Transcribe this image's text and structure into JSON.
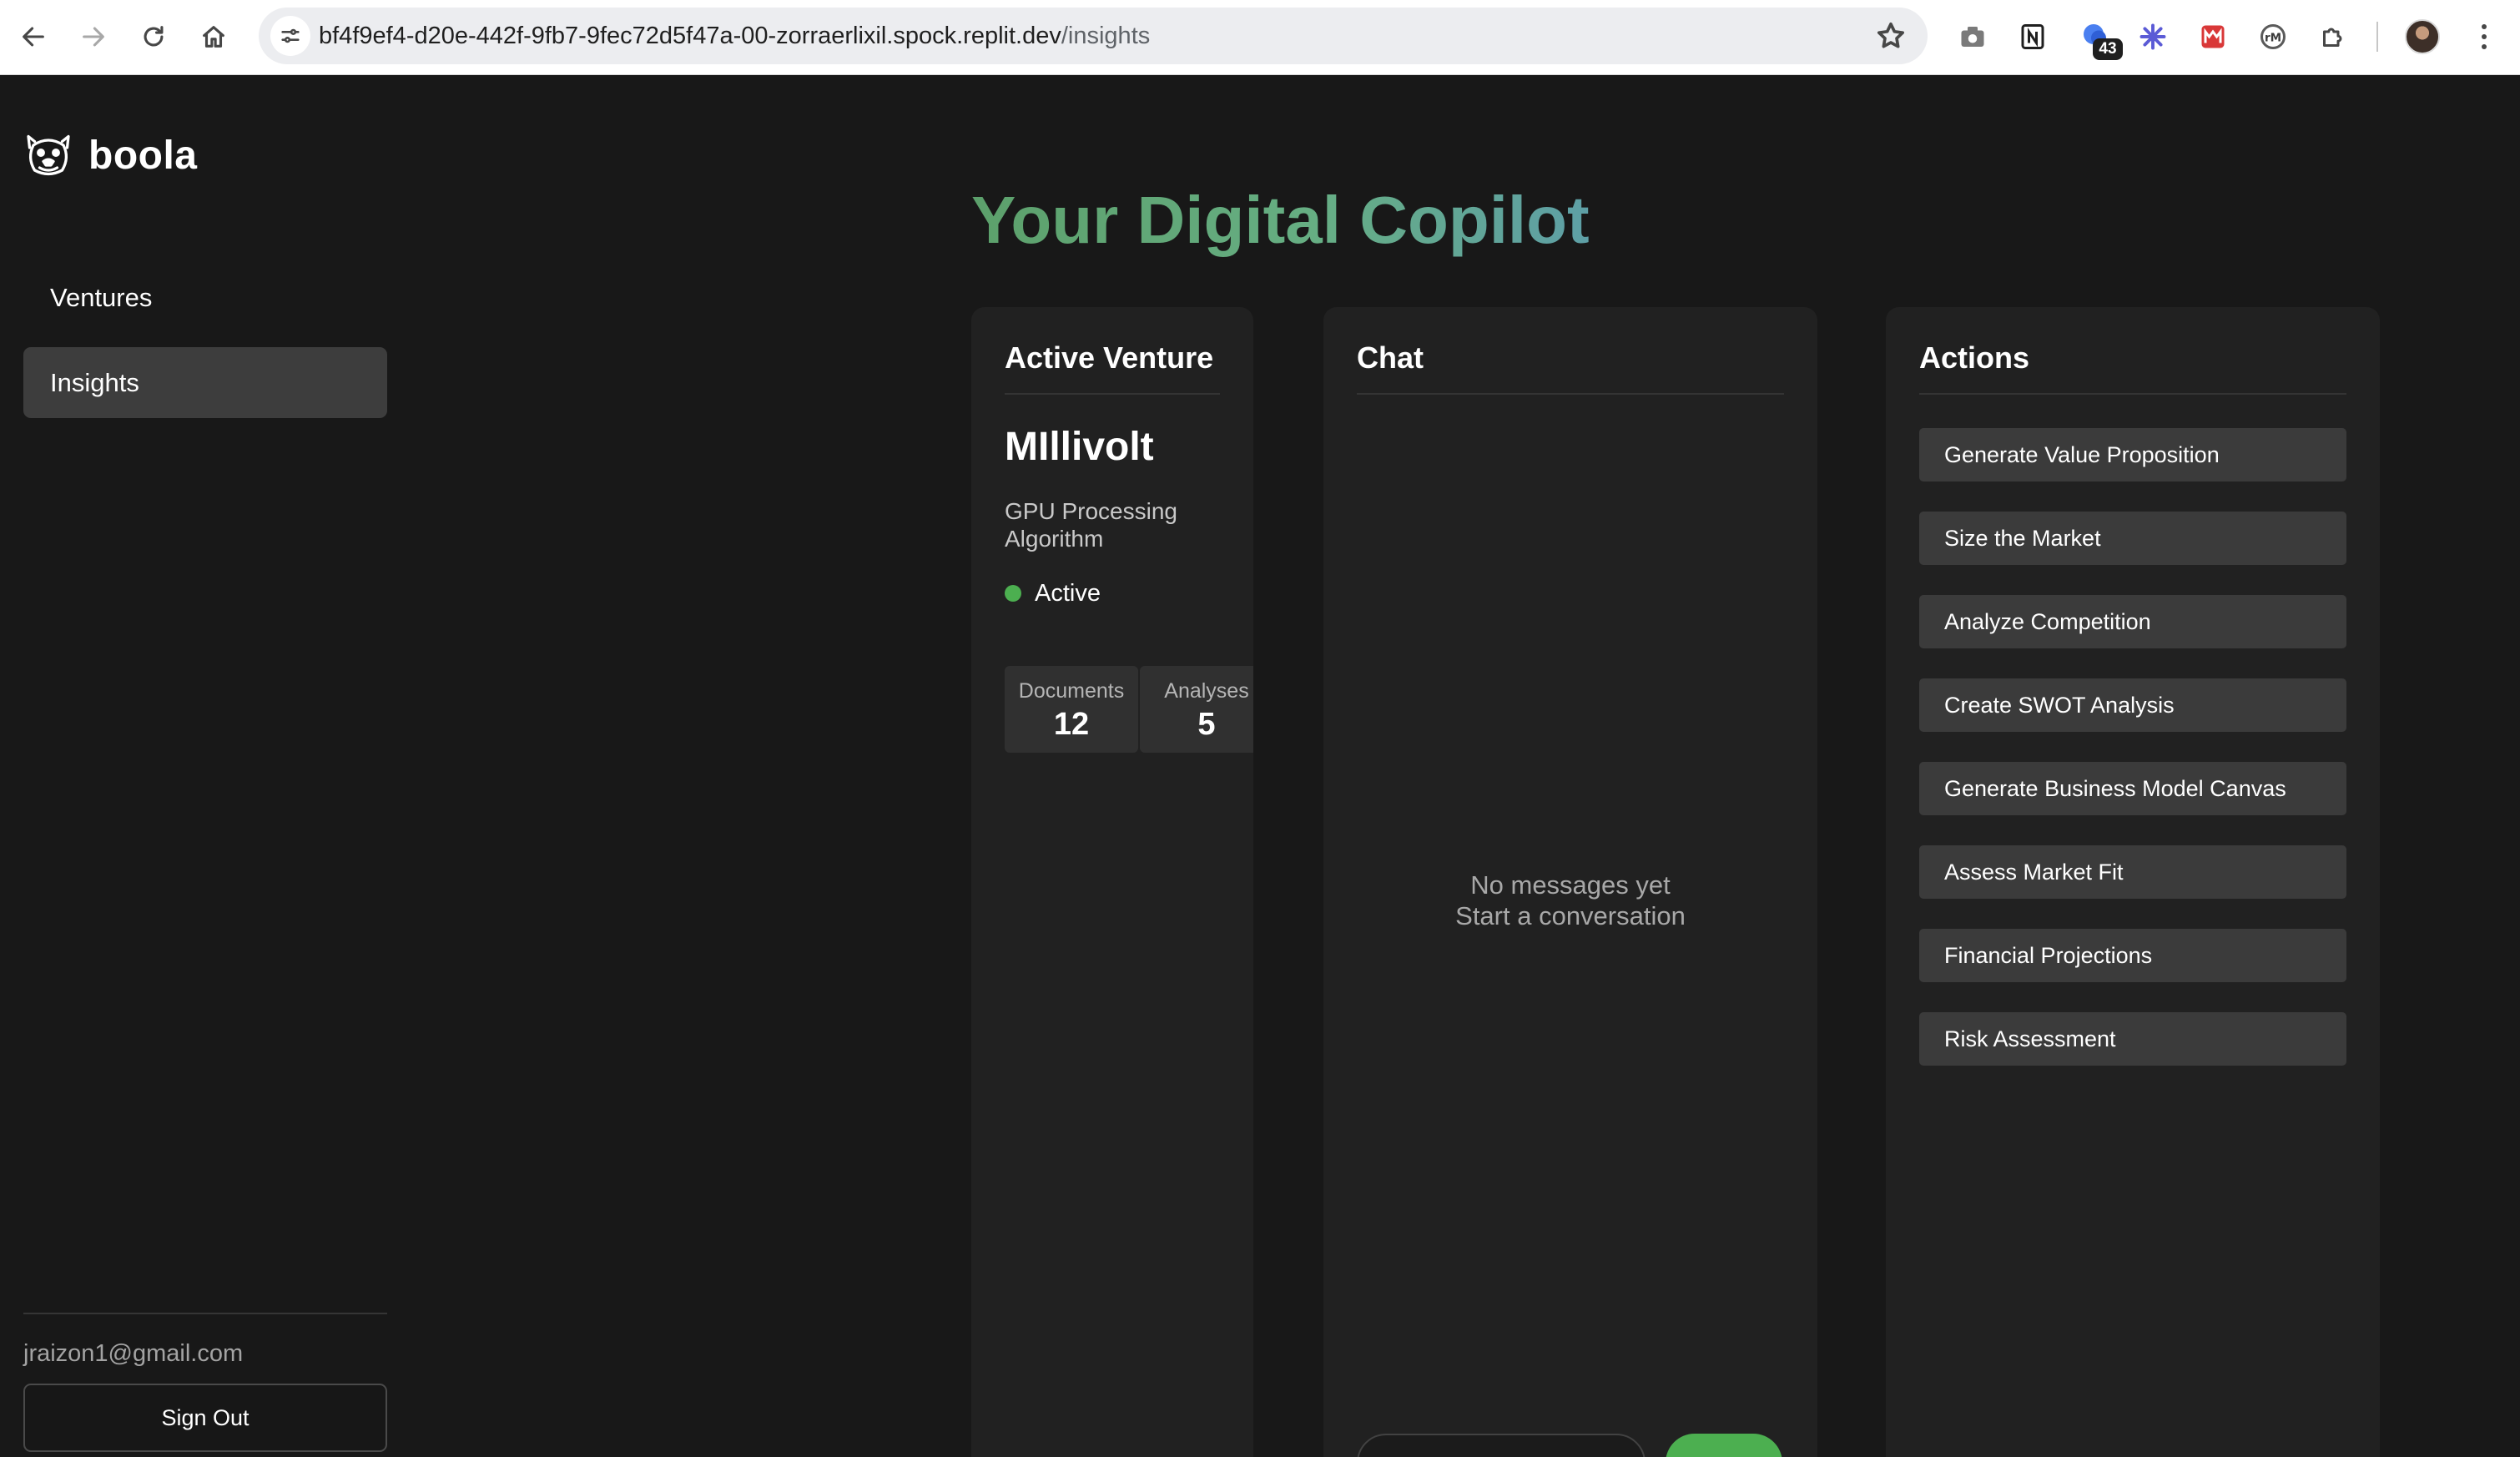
{
  "browser": {
    "url_host": "bf4f9ef4-d20e-442f-9fb7-9fec72d5f47a-00-zorraerlixil.spock.replit.dev",
    "url_path": "/insights",
    "extension_badge": "43"
  },
  "app": {
    "brand": "boola",
    "sidebar": {
      "items": [
        {
          "label": "Ventures",
          "active": false
        },
        {
          "label": "Insights",
          "active": true
        }
      ],
      "user_email": "jraizon1@gmail.com",
      "sign_out_label": "Sign Out"
    },
    "page_title": "Your Digital Copilot",
    "venture_panel": {
      "heading": "Active Venture",
      "name": "MIllivolt",
      "description": "GPU Processing Algorithm",
      "status": "Active",
      "stats": [
        {
          "label": "Documents",
          "value": "12"
        },
        {
          "label": "Analyses",
          "value": "5"
        }
      ]
    },
    "chat_panel": {
      "heading": "Chat",
      "empty_line1": "No messages yet",
      "empty_line2": "Start a conversation"
    },
    "actions_panel": {
      "heading": "Actions",
      "items": [
        "Generate Value Proposition",
        "Size the Market",
        "Analyze Competition",
        "Create SWOT Analysis",
        "Generate Business Model Canvas",
        "Assess Market Fit",
        "Financial Projections",
        "Risk Assessment"
      ]
    }
  },
  "colors": {
    "background": "#181818",
    "panel": "#212121",
    "accent_green": "#4caf50",
    "title_gradient_start": "#5ca06b",
    "title_gradient_end": "#5e9fa6"
  }
}
